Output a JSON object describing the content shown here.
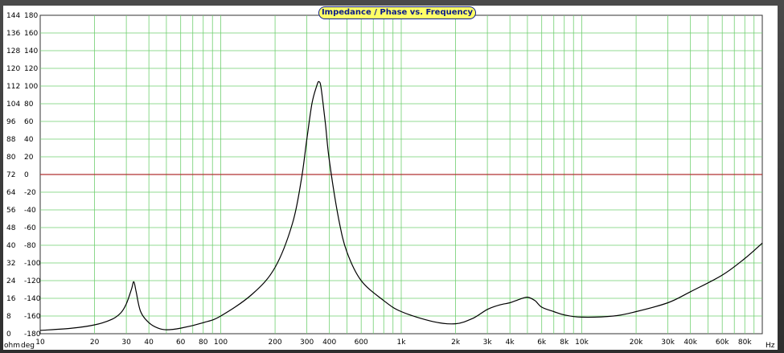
{
  "chart_data": {
    "type": "line",
    "title": "Impedance / Phase vs. Frequency",
    "x_unit_label": "Hz",
    "y_left_unit_label": "ohm",
    "y_right_unit_label": "deg",
    "x_scale": "log",
    "xlim": [
      10,
      100000
    ],
    "ylim_ohm": [
      0,
      144
    ],
    "ylim_deg": [
      -180,
      180
    ],
    "grid": true,
    "x_ticks": [
      {
        "value": 10,
        "label": "10"
      },
      {
        "value": 20,
        "label": "20"
      },
      {
        "value": 30,
        "label": "30"
      },
      {
        "value": 40,
        "label": "40"
      },
      {
        "value": 60,
        "label": "60"
      },
      {
        "value": 80,
        "label": "80"
      },
      {
        "value": 100,
        "label": "100"
      },
      {
        "value": 200,
        "label": "200"
      },
      {
        "value": 300,
        "label": "300"
      },
      {
        "value": 400,
        "label": "400"
      },
      {
        "value": 600,
        "label": "600"
      },
      {
        "value": 1000,
        "label": "1k"
      },
      {
        "value": 2000,
        "label": "2k"
      },
      {
        "value": 3000,
        "label": "3k"
      },
      {
        "value": 4000,
        "label": "4k"
      },
      {
        "value": 6000,
        "label": "6k"
      },
      {
        "value": 8000,
        "label": "8k"
      },
      {
        "value": 10000,
        "label": "10k"
      },
      {
        "value": 20000,
        "label": "20k"
      },
      {
        "value": 30000,
        "label": "30k"
      },
      {
        "value": 40000,
        "label": "40k"
      },
      {
        "value": 60000,
        "label": "60k"
      },
      {
        "value": 80000,
        "label": "80k"
      }
    ],
    "y_ticks_ohm": [
      "144",
      "136",
      "128",
      "120",
      "112",
      "104",
      "96",
      "88",
      "80",
      "72",
      "64",
      "56",
      "48",
      "40",
      "32",
      "24",
      "16",
      "8",
      "0"
    ],
    "y_ticks_deg": [
      "180",
      "160",
      "140",
      "120",
      "100",
      "80",
      "60",
      "40",
      "20",
      "0",
      "-20",
      "-40",
      "-60",
      "-80",
      "-100",
      "-120",
      "-140",
      "-160",
      "-180"
    ],
    "zero_line": {
      "axis": "deg",
      "value": 0,
      "color": "#b03030"
    },
    "series": [
      {
        "color": "#000000",
        "x": [
          10,
          15,
          20,
          25,
          28,
          30,
          32,
          33,
          34,
          36,
          40,
          45,
          50,
          60,
          80,
          100,
          150,
          200,
          250,
          280,
          300,
          320,
          340,
          350,
          360,
          380,
          400,
          450,
          500,
          600,
          800,
          1000,
          1500,
          2000,
          2500,
          3000,
          3500,
          4000,
          4500,
          5000,
          5500,
          6000,
          7000,
          8000,
          10000,
          15000,
          20000,
          30000,
          40000,
          60000,
          80000,
          100000
        ],
        "y": [
          1.5,
          2.5,
          4,
          6.5,
          9.5,
          13.5,
          20,
          23.5,
          19,
          10,
          5,
          2.5,
          1.8,
          2.5,
          5,
          8,
          18,
          30,
          50,
          70,
          88,
          104,
          112,
          114,
          111,
          95,
          78,
          52,
          37,
          24,
          15,
          10,
          5.5,
          4.5,
          7,
          11,
          13,
          14,
          15.5,
          16.5,
          15,
          12,
          10,
          8.5,
          7.5,
          8,
          10,
          14,
          19,
          26.5,
          34,
          41
        ]
      }
    ]
  },
  "labels": {
    "ohm": "ohm",
    "deg": "deg",
    "hz": "Hz"
  },
  "colors": {
    "grid": "#6fcf6f",
    "curve": "#000000",
    "zero_line": "#b03030",
    "title_bg": "#ffff66",
    "title_fg": "#0b1a8a"
  }
}
